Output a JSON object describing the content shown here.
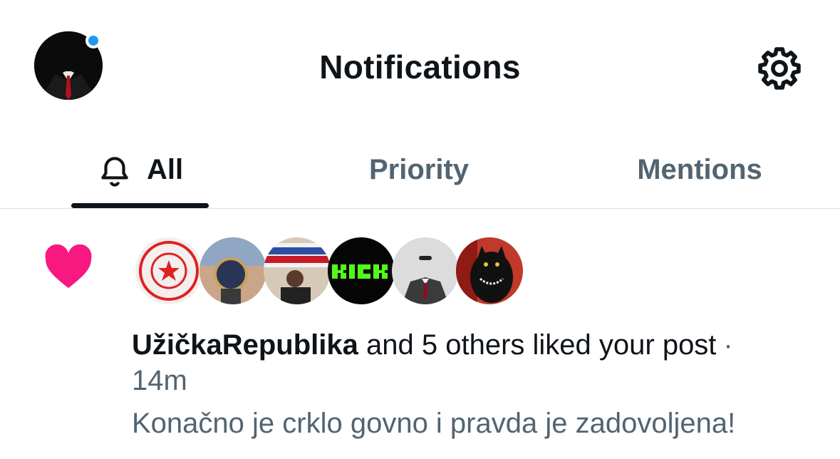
{
  "header": {
    "title": "Notifications",
    "avatar_icon": "profile-avatar",
    "settings_icon": "gear-icon",
    "unread_dot_color": "#1d9bf0"
  },
  "tabs": [
    {
      "label": "All",
      "icon": "bell-icon",
      "active": true
    },
    {
      "label": "Priority",
      "active": false
    },
    {
      "label": "Mentions",
      "active": false
    }
  ],
  "notification": {
    "type_icon": "heart-icon",
    "type_color": "#f91880",
    "liker_avatars": [
      "uzicka-republika-seal",
      "wristwatch-photo",
      "protest-photo",
      "kick-logo",
      "suited-man-photo",
      "black-cat-photo"
    ],
    "actor_name": "UžičkaRepublika",
    "action_text": "and 5 others liked your post",
    "separator": "·",
    "time": "14m",
    "post_preview": "Konačno je crklo govno i pravda je zadovoljena!"
  }
}
